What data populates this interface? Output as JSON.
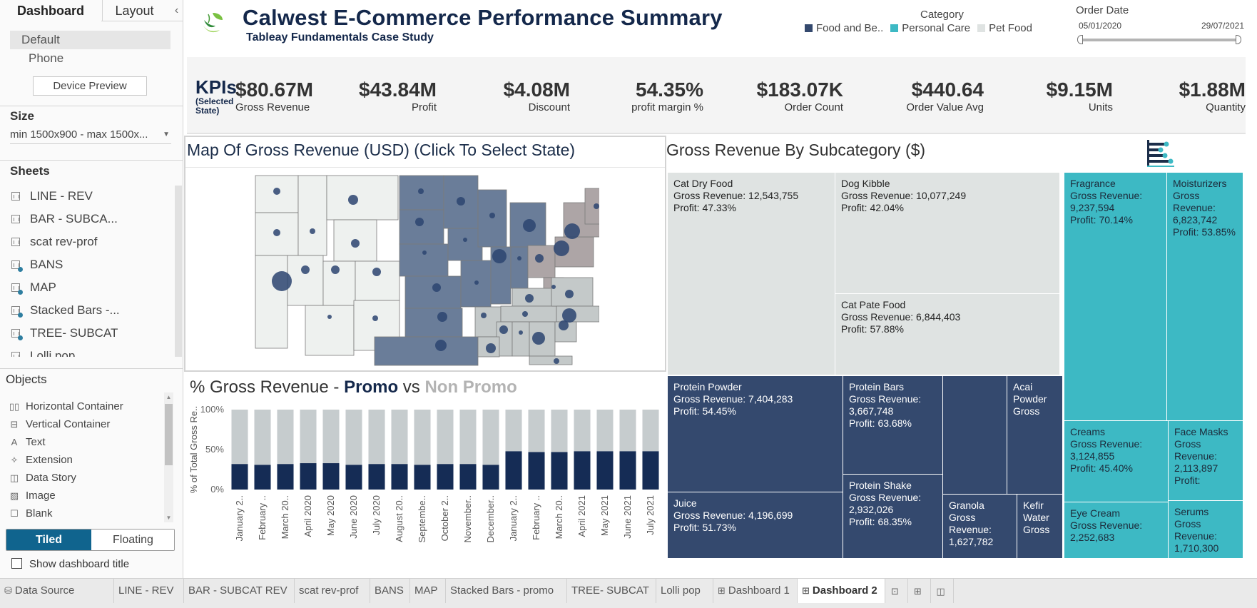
{
  "left_panel": {
    "tabs": {
      "dashboard": "Dashboard",
      "layout": "Layout",
      "collapse": "‹"
    },
    "devices": {
      "default": "Default",
      "phone": "Phone",
      "preview_button": "Device Preview"
    },
    "size": {
      "title": "Size",
      "value": "min 1500x900 - max 1500x..."
    },
    "sheets": {
      "title": "Sheets",
      "items": [
        {
          "label": "LINE - REV",
          "used": false
        },
        {
          "label": "BAR - SUBCA...",
          "used": false
        },
        {
          "label": "scat rev-prof",
          "used": false
        },
        {
          "label": "BANS",
          "used": true
        },
        {
          "label": "MAP",
          "used": true
        },
        {
          "label": "Stacked Bars -...",
          "used": true
        },
        {
          "label": "TREE- SUBCAT",
          "used": true
        },
        {
          "label": "Lolli pop",
          "used": false
        }
      ]
    },
    "objects": {
      "title": "Objects",
      "items": [
        {
          "label": "Horizontal Container",
          "icon": "horizontal-container-icon",
          "glyph": "▯▯"
        },
        {
          "label": "Vertical Container",
          "icon": "vertical-container-icon",
          "glyph": "⊟"
        },
        {
          "label": "Text",
          "icon": "text-icon",
          "glyph": "A"
        },
        {
          "label": "Extension",
          "icon": "extension-icon",
          "glyph": "✧"
        },
        {
          "label": "Data Story",
          "icon": "data-story-icon",
          "glyph": "◫"
        },
        {
          "label": "Image",
          "icon": "image-icon",
          "glyph": "▨"
        },
        {
          "label": "Blank",
          "icon": "blank-icon",
          "glyph": "☐"
        }
      ]
    },
    "layout_mode": {
      "tiled": "Tiled",
      "floating": "Floating",
      "selected": "Tiled"
    },
    "show_dashboard_title": {
      "label": "Show dashboard title",
      "checked": false
    }
  },
  "header": {
    "title": "Calwest E-Commerce Performance Summary",
    "subtitle": "Tableay Fundamentals Case Study",
    "category_legend": {
      "title": "Category",
      "items": [
        {
          "label": "Food and Be..",
          "color": "#34496e"
        },
        {
          "label": "Personal Care",
          "color": "#3db9c4"
        },
        {
          "label": "Pet Food",
          "color": "#dfe3e2"
        }
      ]
    },
    "order_date": {
      "title": "Order Date",
      "start": "05/01/2020",
      "end": "29/07/2021"
    }
  },
  "kpis": {
    "heading": "KPIs",
    "heading_note": "(Selected State)",
    "items": [
      {
        "value": "$80.67M",
        "label": "Gross Revenue"
      },
      {
        "value": "$43.84M",
        "label": "Profit"
      },
      {
        "value": "$4.08M",
        "label": "Discount"
      },
      {
        "value": "54.35%",
        "label": "profit margin %"
      },
      {
        "value": "$183.07K",
        "label": "Order Count"
      },
      {
        "value": "$440.64",
        "label": "Order Value Avg"
      },
      {
        "value": "$9.15M",
        "label": "Units"
      },
      {
        "value": "$1.88M",
        "label": "Quantity"
      }
    ]
  },
  "map": {
    "title": "Map Of Gross Revenue (USD) (Click To Select State)",
    "region_colors": {
      "west": "#eef1ef",
      "central": "#6a7d99",
      "midwest": "#6a7d99",
      "south": "#c4c9c9",
      "northeast": "#ada5a6"
    },
    "bubble_color": "#2b4470"
  },
  "promo_chart": {
    "title_prefix": "% Gross Revenue - ",
    "title_promo": "Promo",
    "title_vs": " vs ",
    "title_nonpromo": "Non Promo"
  },
  "chart_data": {
    "type": "bar",
    "stacked": true,
    "title": "% Gross Revenue - Promo vs Non Promo",
    "xlabel": "",
    "ylabel": "% of Total Gross Re..",
    "ylim": [
      0,
      100
    ],
    "yticks": [
      "0%",
      "50%",
      "100%"
    ],
    "categories": [
      "January 2..",
      "February ..",
      "March 20..",
      "April 2020",
      "May 2020",
      "June 2020",
      "July 2020",
      "August 20..",
      "Septembe..",
      "October 2..",
      "November..",
      "December..",
      "January 2..",
      "February ..",
      "March 20..",
      "April 2021",
      "May 2021",
      "June 2021",
      "July 2021"
    ],
    "series": [
      {
        "name": "Promo",
        "color": "#152c55",
        "values": [
          32,
          31,
          32,
          33,
          33,
          31,
          32,
          32,
          31,
          32,
          32,
          31,
          48,
          47,
          47,
          48,
          48,
          48,
          48
        ]
      },
      {
        "name": "Non Promo",
        "color": "#c6ccce",
        "values": [
          68,
          69,
          68,
          67,
          67,
          69,
          68,
          68,
          69,
          68,
          68,
          69,
          52,
          53,
          53,
          52,
          52,
          52,
          52
        ]
      }
    ]
  },
  "treemap": {
    "title": "Gross Revenue By Subcategory ($)",
    "gross_label": "Gross Revenue:",
    "profit_label": "Profit:",
    "tiles": [
      {
        "name": "Cat Dry Food",
        "category": "pet",
        "revenue": "12,543,755",
        "profit": "47.33%"
      },
      {
        "name": "Dog Kibble",
        "category": "pet",
        "revenue": "10,077,249",
        "profit": "42.04%"
      },
      {
        "name": "Cat Pate Food",
        "category": "pet",
        "revenue": "6,844,403",
        "profit": "57.88%"
      },
      {
        "name": "Protein Powder",
        "category": "food",
        "revenue": "7,404,283",
        "profit": "54.45%"
      },
      {
        "name": "Juice",
        "category": "food",
        "revenue": "4,196,699",
        "profit": "51.73%"
      },
      {
        "name": "Protein Bars",
        "category": "food",
        "revenue": "3,667,748",
        "profit": "63.68%"
      },
      {
        "name": "Protein Shake",
        "category": "food",
        "revenue": "2,932,026",
        "profit": "68.35%"
      },
      {
        "name": "",
        "category": "food",
        "revenue": "",
        "profit": ""
      },
      {
        "name": "Acai Powder",
        "category": "food",
        "revenue": "",
        "profit": "",
        "truncated": "Gross"
      },
      {
        "name": "Granola",
        "category": "food",
        "revenue": "1,627,782",
        "profit": ""
      },
      {
        "name": "Kefir Water",
        "category": "food",
        "revenue": "",
        "profit": "",
        "truncated": "Gross"
      },
      {
        "name": "Fragrance",
        "category": "care",
        "revenue": "9,237,594",
        "profit": "70.14%"
      },
      {
        "name": "Moisturizers",
        "category": "care",
        "revenue": "6,823,742",
        "profit": "53.85%"
      },
      {
        "name": "Creams",
        "category": "care",
        "revenue": "3,124,855",
        "profit": "45.40%"
      },
      {
        "name": "Face Masks",
        "category": "care",
        "revenue": "2,113,897",
        "profit": ""
      },
      {
        "name": "Eye Cream",
        "category": "care",
        "revenue": "2,252,683",
        "profit": ""
      },
      {
        "name": "Serums",
        "category": "care",
        "revenue": "1,710,300",
        "profit": ""
      }
    ]
  },
  "bottom_tabs": {
    "data_source": "Data Source",
    "sheets": [
      "LINE - REV",
      "BAR - SUBCAT REV",
      "scat rev-prof",
      "BANS",
      "MAP",
      "Stacked Bars - promo",
      "TREE- SUBCAT",
      "Lolli pop"
    ],
    "dashboards": [
      "Dashboard 1",
      "Dashboard 2"
    ],
    "active": "Dashboard 2"
  }
}
